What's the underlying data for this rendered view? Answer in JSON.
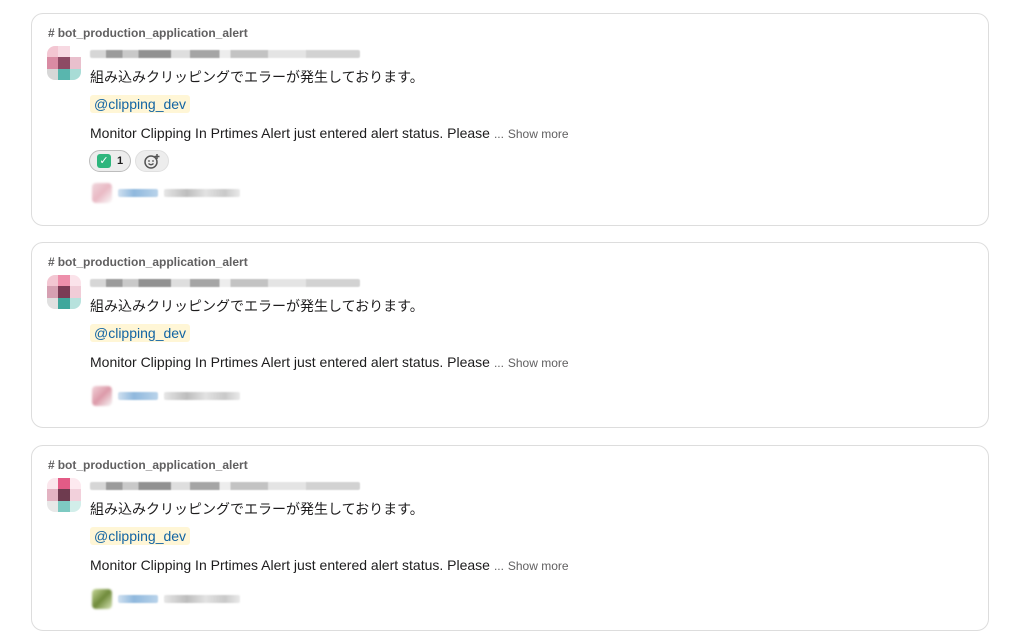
{
  "messages": [
    {
      "channel": "bot_production_application_alert",
      "jp_text": "組み込みクリッピングでエラーが発生しております。",
      "mention": "@clipping_dev",
      "body": "Monitor Clipping In Prtimes Alert just entered alert status. Please",
      "ellipsis": "...",
      "show_more": "Show more",
      "reaction": {
        "emoji_icon": "white-check-mark-icon",
        "count": "1"
      }
    },
    {
      "channel": "bot_production_application_alert",
      "jp_text": "組み込みクリッピングでエラーが発生しております。",
      "mention": "@clipping_dev",
      "body": "Monitor Clipping In Prtimes Alert just entered alert status. Please",
      "ellipsis": "...",
      "show_more": "Show more"
    },
    {
      "channel": "bot_production_application_alert",
      "jp_text": "組み込みクリッピングでエラーが発生しております。",
      "mention": "@clipping_dev",
      "body": "Monitor Clipping In Prtimes Alert just entered alert status. Please",
      "ellipsis": "...",
      "show_more": "Show more"
    }
  ],
  "hash_symbol": "#",
  "check_glyph": "✓",
  "colors": {
    "mention_bg": "#fff6d6",
    "mention_text": "#1264a3",
    "check_green": "#2eb67d"
  }
}
